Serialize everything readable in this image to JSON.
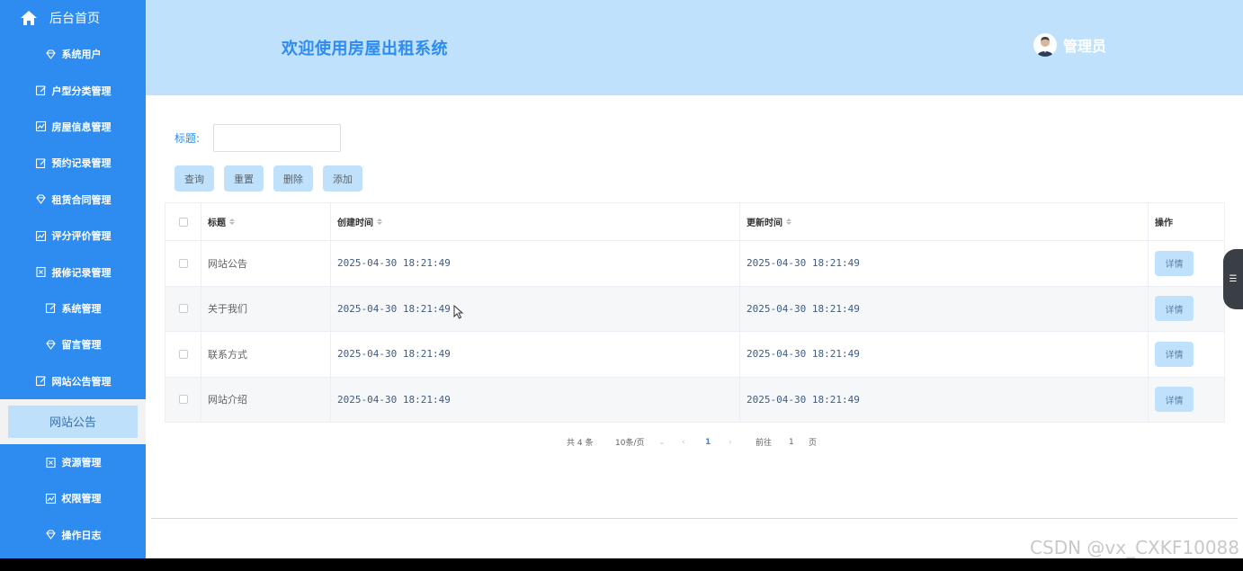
{
  "sidebar": {
    "home_label": "后台首页",
    "items": [
      {
        "label": "系统用户",
        "icon": "diamond-icon"
      },
      {
        "label": "户型分类管理",
        "icon": "edit-icon"
      },
      {
        "label": "房屋信息管理",
        "icon": "chart-icon"
      },
      {
        "label": "预约记录管理",
        "icon": "edit-icon"
      },
      {
        "label": "租赁合同管理",
        "icon": "diamond-icon"
      },
      {
        "label": "评分评价管理",
        "icon": "chart-icon"
      },
      {
        "label": "报修记录管理",
        "icon": "document-icon"
      },
      {
        "label": "系统管理",
        "icon": "edit-icon"
      },
      {
        "label": "留言管理",
        "icon": "diamond-icon"
      },
      {
        "label": "网站公告管理",
        "icon": "edit-icon"
      }
    ],
    "active_sub": "网站公告",
    "items_after": [
      {
        "label": "资源管理",
        "icon": "document-icon"
      },
      {
        "label": "权限管理",
        "icon": "chart-icon"
      },
      {
        "label": "操作日志",
        "icon": "diamond-icon"
      }
    ]
  },
  "header": {
    "title": "欢迎使用房屋出租系统",
    "user_name": "管理员"
  },
  "search": {
    "label": "标题:",
    "value": ""
  },
  "buttons": {
    "query": "查询",
    "reset": "重置",
    "delete": "删除",
    "add": "添加"
  },
  "table": {
    "columns": [
      "标题",
      "创建时间",
      "更新时间",
      "操作"
    ],
    "rows": [
      {
        "title": "网站公告",
        "created": "2025-04-30 18:21:49",
        "updated": "2025-04-30 18:21:49",
        "action": "详情"
      },
      {
        "title": "关于我们",
        "created": "2025-04-30 18:21:49",
        "updated": "2025-04-30 18:21:49",
        "action": "详情"
      },
      {
        "title": "联系方式",
        "created": "2025-04-30 18:21:49",
        "updated": "2025-04-30 18:21:49",
        "action": "详情"
      },
      {
        "title": "网站介绍",
        "created": "2025-04-30 18:21:49",
        "updated": "2025-04-30 18:21:49",
        "action": "详情"
      }
    ]
  },
  "pagination": {
    "total": "共 4 条",
    "page_size": "10条/页",
    "current_page": "1",
    "goto_label": "前往",
    "goto_value": "1",
    "page_suffix": "页"
  },
  "watermark": "CSDN @vx_CXKF10088",
  "colors": {
    "sidebar": "#2e8bf0",
    "header": "#bfe1fb",
    "accent": "#2e8bf0",
    "button": "#bfe1fb"
  }
}
